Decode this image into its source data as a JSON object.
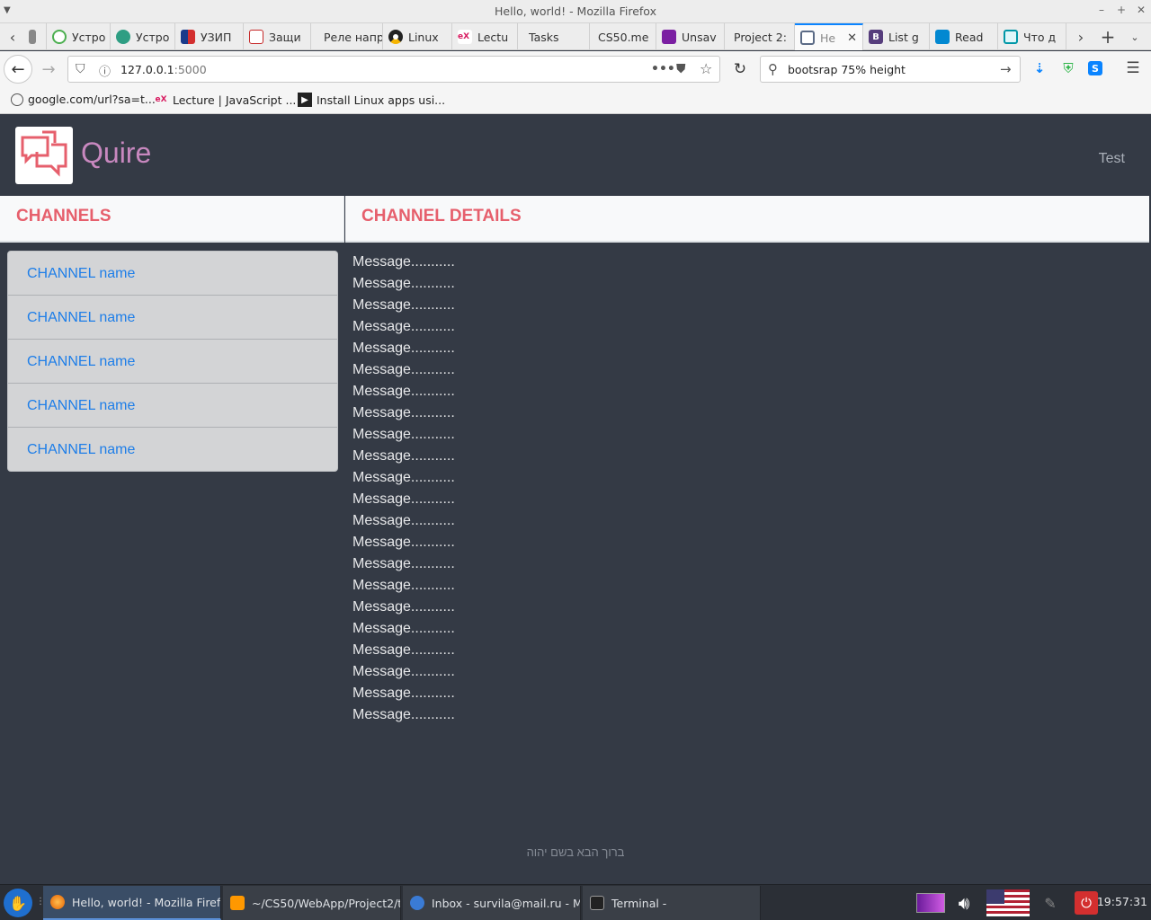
{
  "window": {
    "title": "Hello, world! - Mozilla Firefox"
  },
  "tabs": [
    {
      "label": "Устро",
      "color": "#4caf50"
    },
    {
      "label": "Устро",
      "color": "#2e9e83"
    },
    {
      "label": "УЗИП",
      "color": "#d32f2f"
    },
    {
      "label": "Защи",
      "color": "#c62828"
    },
    {
      "label": "Реле напр",
      "color": ""
    },
    {
      "label": "Linux",
      "color": "#333333"
    },
    {
      "label": "Lectu",
      "color": "#d81b60"
    },
    {
      "label": "Tasks",
      "color": ""
    },
    {
      "label": "CS50.me",
      "color": ""
    },
    {
      "label": "Unsav",
      "color": "#7b1fa2"
    },
    {
      "label": "Project 2:",
      "color": ""
    },
    {
      "label": "He",
      "color": "#5b6b86",
      "active": true
    },
    {
      "label": "List g",
      "color": "#563d7c"
    },
    {
      "label": "Read",
      "color": "#0288d1"
    },
    {
      "label": "Что д",
      "color": "#0097a7"
    }
  ],
  "nav": {
    "url_host": "127.0.0.1",
    "url_port": ":5000",
    "search_value": "bootsrap 75% height"
  },
  "bookmarks": [
    {
      "label": "google.com/url?sa=t..."
    },
    {
      "label": "Lecture | JavaScript ..."
    },
    {
      "label": "Install Linux apps usi..."
    }
  ],
  "app": {
    "brand": "Quire",
    "user": "Test",
    "channels_heading": "CHANNELS",
    "details_heading": "CHANNEL DETAILS",
    "channels": [
      "CHANNEL name",
      "CHANNEL name",
      "CHANNEL name",
      "CHANNEL name",
      "CHANNEL name"
    ],
    "messages": [
      "Message...........",
      "Message...........",
      "Message...........",
      "Message...........",
      "Message...........",
      "Message...........",
      "Message...........",
      "Message...........",
      "Message...........",
      "Message...........",
      "Message...........",
      "Message...........",
      "Message...........",
      "Message...........",
      "Message...........",
      "Message...........",
      "Message...........",
      "Message...........",
      "Message...........",
      "Message...........",
      "Message...........",
      "Message..........."
    ],
    "footer": "ברוך הבא בשם יהוה",
    "accent": "#e65f6c",
    "brand_color": "#c888bf",
    "link_color": "#1e7ee8"
  },
  "taskbar": {
    "tasks": [
      {
        "label": "Hello, world! - Mozilla Firefox",
        "active": true
      },
      {
        "label": "~/CS50/WebApp/Project2/te..."
      },
      {
        "label": "Inbox - survila@mail.ru - Mo..."
      },
      {
        "label": "Terminal -"
      }
    ],
    "clock": "19:57:31"
  }
}
